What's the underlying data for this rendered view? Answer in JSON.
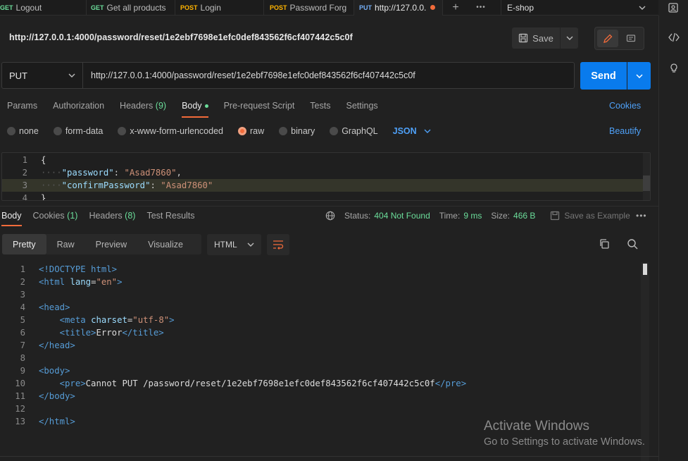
{
  "tabs": [
    {
      "method": "GET",
      "label": "Logout"
    },
    {
      "method": "GET",
      "label": "Get all products"
    },
    {
      "method": "POST",
      "label": "Login"
    },
    {
      "method": "POST",
      "label": "Password Forg"
    },
    {
      "method": "PUT",
      "label": "http://127.0.0."
    }
  ],
  "more_dots": "•••",
  "environment": "E-shop",
  "request": {
    "title_url": "http://127.0.0.1:4000/password/reset/1e2ebf7698e1efc0def843562f6cf407442c5c0f",
    "method": "PUT",
    "url": "http://127.0.0.1:4000/password/reset/1e2ebf7698e1efc0def843562f6cf407442c5c0f",
    "save_label": "Save",
    "send_label": "Send"
  },
  "request_tabs": {
    "params": "Params",
    "authorization": "Authorization",
    "headers": "Headers",
    "headers_count": "(9)",
    "body": "Body",
    "pre_request": "Pre-request Script",
    "tests": "Tests",
    "settings": "Settings",
    "cookies": "Cookies"
  },
  "body_types": {
    "none": "none",
    "form_data": "form-data",
    "urlencoded": "x-www-form-urlencoded",
    "raw": "raw",
    "binary": "binary",
    "graphql": "GraphQL",
    "json": "JSON",
    "beautify": "Beautify"
  },
  "request_body": {
    "lines": [
      {
        "n": "1",
        "text": "{"
      },
      {
        "n": "2",
        "key": "\"password\"",
        "value": "\"Asad7860\"",
        "trail": ","
      },
      {
        "n": "3",
        "key": "\"confirmPassword\"",
        "value": "\"Asad7860\"",
        "trail": ""
      },
      {
        "n": "4",
        "text": "}"
      }
    ]
  },
  "response_tabs": {
    "body": "Body",
    "cookies": "Cookies",
    "cookies_count": "(1)",
    "headers": "Headers",
    "headers_count": "(8)",
    "test_results": "Test Results"
  },
  "status": {
    "status_label": "Status:",
    "status_value": "404 Not Found",
    "time_label": "Time:",
    "time_value": "9 ms",
    "size_label": "Size:",
    "size_value": "466 B",
    "save_example": "Save as Example"
  },
  "view_tabs": {
    "pretty": "Pretty",
    "raw": "Raw",
    "preview": "Preview",
    "visualize": "Visualize",
    "language": "HTML"
  },
  "response_body": {
    "line_numbers": [
      "1",
      "2",
      "3",
      "4",
      "5",
      "6",
      "7",
      "8",
      "9",
      "10",
      "11",
      "12",
      "13"
    ],
    "doctype": "<!DOCTYPE html>",
    "html_open_tag": "<html",
    "lang_attr": "lang",
    "lang_value": "\"en\"",
    "head_open": "<head>",
    "meta_tag": "<meta",
    "charset_attr": "charset",
    "charset_value": "\"utf-8\"",
    "title_open": "<title>",
    "title_text": "Error",
    "title_close": "</title>",
    "head_close": "</head>",
    "body_open": "<body>",
    "pre_open": "<pre>",
    "pre_text": "Cannot PUT /password/reset/1e2ebf7698e1efc0def843562f6cf407442c5c0f",
    "pre_close": "</pre>",
    "body_close": "</body>",
    "html_close": "</html>"
  },
  "watermark": {
    "line1": "Activate Windows",
    "line2": "Go to Settings to activate Windows."
  },
  "colors": {
    "accent": "#f26b3a",
    "send": "#097bed",
    "link": "#4ea0f7",
    "success": "#6bdd9a"
  }
}
